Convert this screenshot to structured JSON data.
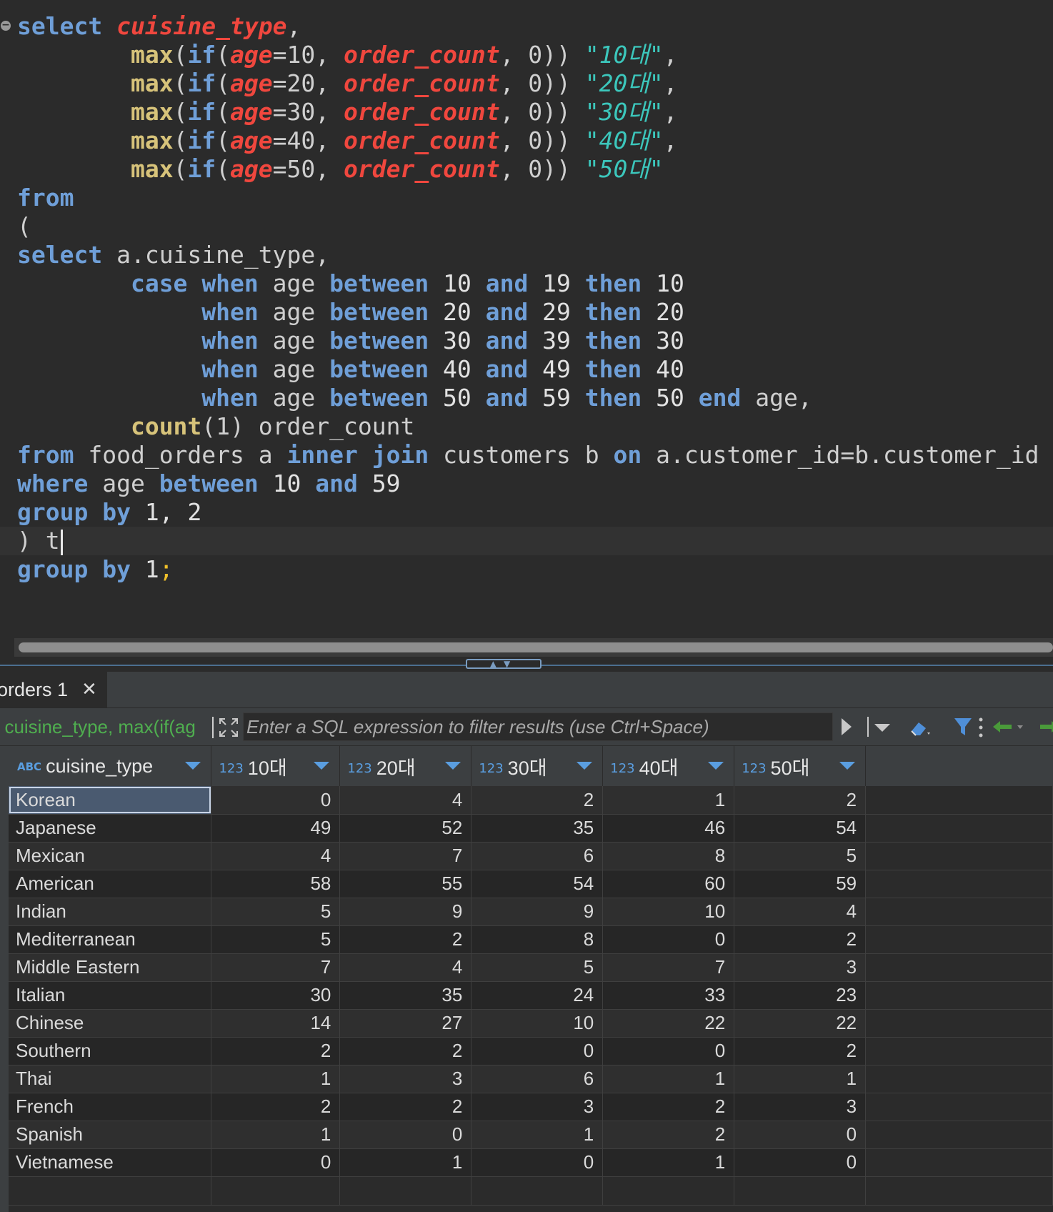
{
  "editor": {
    "lines": [
      [
        [
          "kw",
          "select"
        ],
        [
          "pl",
          " "
        ],
        [
          "fld",
          "cuisine_type"
        ],
        [
          "pl",
          ","
        ]
      ],
      [
        [
          "pl",
          "        "
        ],
        [
          "fn",
          "max"
        ],
        [
          "pl",
          "("
        ],
        [
          "kw",
          "if"
        ],
        [
          "pl",
          "("
        ],
        [
          "fld",
          "age"
        ],
        [
          "pl",
          "=10, "
        ],
        [
          "fld",
          "order_count"
        ],
        [
          "pl",
          ", 0)) "
        ],
        [
          "str",
          "\"10대\""
        ],
        [
          "pl",
          ","
        ]
      ],
      [
        [
          "pl",
          "        "
        ],
        [
          "fn",
          "max"
        ],
        [
          "pl",
          "("
        ],
        [
          "kw",
          "if"
        ],
        [
          "pl",
          "("
        ],
        [
          "fld",
          "age"
        ],
        [
          "pl",
          "=20, "
        ],
        [
          "fld",
          "order_count"
        ],
        [
          "pl",
          ", 0)) "
        ],
        [
          "str",
          "\"20대\""
        ],
        [
          "pl",
          ","
        ]
      ],
      [
        [
          "pl",
          "        "
        ],
        [
          "fn",
          "max"
        ],
        [
          "pl",
          "("
        ],
        [
          "kw",
          "if"
        ],
        [
          "pl",
          "("
        ],
        [
          "fld",
          "age"
        ],
        [
          "pl",
          "=30, "
        ],
        [
          "fld",
          "order_count"
        ],
        [
          "pl",
          ", 0)) "
        ],
        [
          "str",
          "\"30대\""
        ],
        [
          "pl",
          ","
        ]
      ],
      [
        [
          "pl",
          "        "
        ],
        [
          "fn",
          "max"
        ],
        [
          "pl",
          "("
        ],
        [
          "kw",
          "if"
        ],
        [
          "pl",
          "("
        ],
        [
          "fld",
          "age"
        ],
        [
          "pl",
          "=40, "
        ],
        [
          "fld",
          "order_count"
        ],
        [
          "pl",
          ", 0)) "
        ],
        [
          "str",
          "\"40대\""
        ],
        [
          "pl",
          ","
        ]
      ],
      [
        [
          "pl",
          "        "
        ],
        [
          "fn",
          "max"
        ],
        [
          "pl",
          "("
        ],
        [
          "kw",
          "if"
        ],
        [
          "pl",
          "("
        ],
        [
          "fld",
          "age"
        ],
        [
          "pl",
          "=50, "
        ],
        [
          "fld",
          "order_count"
        ],
        [
          "pl",
          ", 0)) "
        ],
        [
          "str",
          "\"50대\""
        ]
      ],
      [
        [
          "kw",
          "from"
        ]
      ],
      [
        [
          "pl",
          "("
        ]
      ],
      [
        [
          "kw",
          "select"
        ],
        [
          "pl",
          " a.cuisine_type,"
        ]
      ],
      [
        [
          "pl",
          "        "
        ],
        [
          "kw",
          "case"
        ],
        [
          "pl",
          " "
        ],
        [
          "kw",
          "when"
        ],
        [
          "pl",
          " age "
        ],
        [
          "kw",
          "between"
        ],
        [
          "num",
          " 10 "
        ],
        [
          "kw",
          "and"
        ],
        [
          "num",
          " 19 "
        ],
        [
          "kw",
          "then"
        ],
        [
          "num",
          " 10"
        ]
      ],
      [
        [
          "pl",
          "             "
        ],
        [
          "kw",
          "when"
        ],
        [
          "pl",
          " age "
        ],
        [
          "kw",
          "between"
        ],
        [
          "num",
          " 20 "
        ],
        [
          "kw",
          "and"
        ],
        [
          "num",
          " 29 "
        ],
        [
          "kw",
          "then"
        ],
        [
          "num",
          " 20"
        ]
      ],
      [
        [
          "pl",
          "             "
        ],
        [
          "kw",
          "when"
        ],
        [
          "pl",
          " age "
        ],
        [
          "kw",
          "between"
        ],
        [
          "num",
          " 30 "
        ],
        [
          "kw",
          "and"
        ],
        [
          "num",
          " 39 "
        ],
        [
          "kw",
          "then"
        ],
        [
          "num",
          " 30"
        ]
      ],
      [
        [
          "pl",
          "             "
        ],
        [
          "kw",
          "when"
        ],
        [
          "pl",
          " age "
        ],
        [
          "kw",
          "between"
        ],
        [
          "num",
          " 40 "
        ],
        [
          "kw",
          "and"
        ],
        [
          "num",
          " 49 "
        ],
        [
          "kw",
          "then"
        ],
        [
          "num",
          " 40"
        ]
      ],
      [
        [
          "pl",
          "             "
        ],
        [
          "kw",
          "when"
        ],
        [
          "pl",
          " age "
        ],
        [
          "kw",
          "between"
        ],
        [
          "num",
          " 50 "
        ],
        [
          "kw",
          "and"
        ],
        [
          "num",
          " 59 "
        ],
        [
          "kw",
          "then"
        ],
        [
          "num",
          " 50 "
        ],
        [
          "kw",
          "end"
        ],
        [
          "pl",
          " age,"
        ]
      ],
      [
        [
          "pl",
          "        "
        ],
        [
          "fn",
          "count"
        ],
        [
          "pl",
          "(1) order_count"
        ]
      ],
      [
        [
          "kw",
          "from"
        ],
        [
          "pl",
          " food_orders a "
        ],
        [
          "kw",
          "inner"
        ],
        [
          "pl",
          " "
        ],
        [
          "kw",
          "join"
        ],
        [
          "pl",
          " customers b "
        ],
        [
          "kw",
          "on"
        ],
        [
          "pl",
          " a.customer_id=b.customer_id"
        ]
      ],
      [
        [
          "kw",
          "where"
        ],
        [
          "pl",
          " age "
        ],
        [
          "kw",
          "between"
        ],
        [
          "num",
          " 10 "
        ],
        [
          "kw",
          "and"
        ],
        [
          "num",
          " 59"
        ]
      ],
      [
        [
          "kw",
          "group"
        ],
        [
          "pl",
          " "
        ],
        [
          "kw",
          "by"
        ],
        [
          "num",
          " 1, 2"
        ]
      ],
      [
        [
          "pl",
          ") t"
        ]
      ],
      [
        [
          "kw",
          "group"
        ],
        [
          "pl",
          " "
        ],
        [
          "kw",
          "by"
        ],
        [
          "num",
          " 1"
        ],
        [
          "semi",
          ";"
        ]
      ]
    ],
    "cursor_line": 18
  },
  "results": {
    "tab_label": "orders 1",
    "filter_query": "t cuisine_type, max(if(ag",
    "filter_placeholder": "Enter a SQL expression to filter results (use Ctrl+Space)",
    "columns": [
      {
        "type": "ABC",
        "name": "cuisine_type"
      },
      {
        "type": "123",
        "name": "10대"
      },
      {
        "type": "123",
        "name": "20대"
      },
      {
        "type": "123",
        "name": "30대"
      },
      {
        "type": "123",
        "name": "40대"
      },
      {
        "type": "123",
        "name": "50대"
      }
    ],
    "rows": [
      [
        "Korean",
        "0",
        "4",
        "2",
        "1",
        "2"
      ],
      [
        "Japanese",
        "49",
        "52",
        "35",
        "46",
        "54"
      ],
      [
        "Mexican",
        "4",
        "7",
        "6",
        "8",
        "5"
      ],
      [
        "American",
        "58",
        "55",
        "54",
        "60",
        "59"
      ],
      [
        "Indian",
        "5",
        "9",
        "9",
        "10",
        "4"
      ],
      [
        "Mediterranean",
        "5",
        "2",
        "8",
        "0",
        "2"
      ],
      [
        "Middle Eastern",
        "7",
        "4",
        "5",
        "7",
        "3"
      ],
      [
        "Italian",
        "30",
        "35",
        "24",
        "33",
        "23"
      ],
      [
        "Chinese",
        "14",
        "27",
        "10",
        "22",
        "22"
      ],
      [
        "Southern",
        "2",
        "2",
        "0",
        "0",
        "2"
      ],
      [
        "Thai",
        "1",
        "3",
        "6",
        "1",
        "1"
      ],
      [
        "French",
        "2",
        "2",
        "3",
        "2",
        "3"
      ],
      [
        "Spanish",
        "1",
        "0",
        "1",
        "2",
        "0"
      ],
      [
        "Vietnamese",
        "0",
        "1",
        "0",
        "1",
        "0"
      ]
    ],
    "selected_cell": "Korean"
  }
}
